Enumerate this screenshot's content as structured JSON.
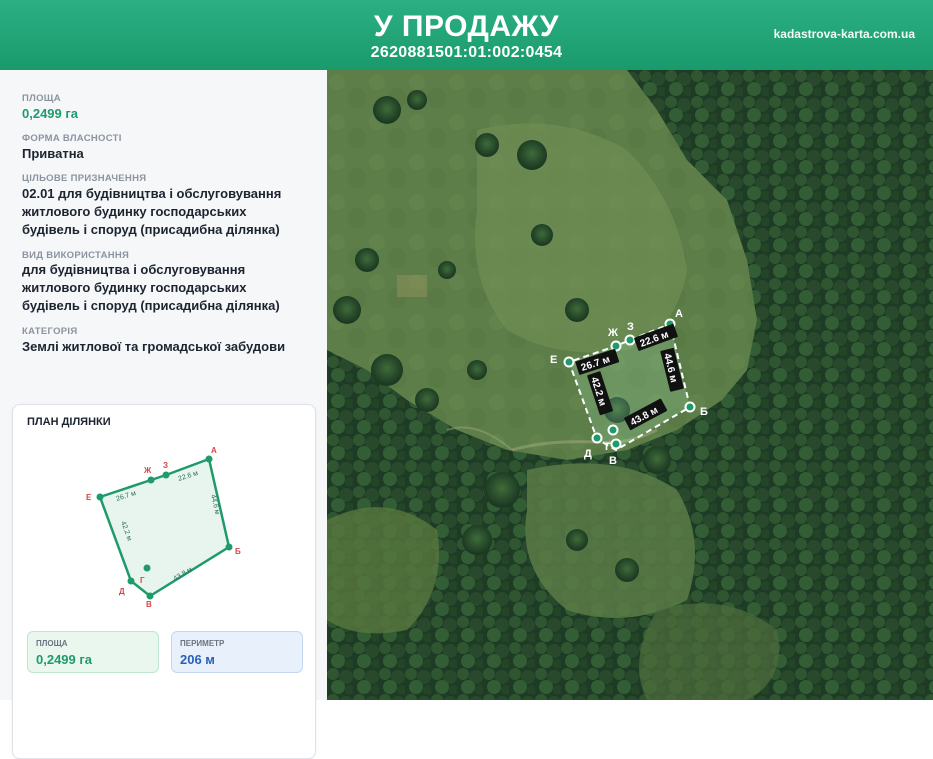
{
  "header": {
    "title": "У ПРОДАЖУ",
    "cadastral_number": "2620881501:01:002:0454",
    "site": "kadastrova-karta.com.ua"
  },
  "info": {
    "area_label": "ПЛОЩА",
    "area_value": "0,2499 га",
    "ownership_label": "ФОРМА ВЛАСНОСТІ",
    "ownership_value": "Приватна",
    "purpose_label": "ЦІЛЬОВЕ ПРИЗНАЧЕННЯ",
    "purpose_lines": [
      "02.01 для будівництва і обслуговування",
      "житлового будинку господарських",
      "будівель і споруд (присадибна ділянка)"
    ],
    "usage_label": "ВИД ВИКОРИСТАННЯ",
    "usage_lines": [
      "для будівництва і обслуговування",
      "житлового будинку господарських",
      "будівель і споруд (присадибна ділянка)"
    ],
    "category_label": "КАТЕГОРІЯ",
    "category_value": "Землі житлової та громадської забудови"
  },
  "plan": {
    "title": "ПЛАН ДІЛЯНКИ",
    "vertices": [
      "А",
      "Б",
      "В",
      "Г",
      "Д",
      "Е",
      "Ж",
      "З"
    ],
    "edges": [
      "22.6 м",
      "44.6 м",
      "43.8 м",
      "42.2 м",
      "26.7 м"
    ],
    "area_label": "ПЛОЩА",
    "area_value": "0,2499 га",
    "perimeter_label": "ПЕРИМЕТР",
    "perimeter_value": "206 м"
  },
  "map": {
    "vertices": [
      "А",
      "Б",
      "В",
      "Г",
      "Д",
      "Е",
      "Ж",
      "З"
    ],
    "edges": [
      "22.6 м",
      "44.6 м",
      "43.8 м",
      "42.2 м",
      "26.7 м"
    ]
  },
  "colors": {
    "brand_green": "#1e9b6c",
    "vertex_red": "#d64545",
    "perimeter_blue": "#2a5fb8"
  }
}
